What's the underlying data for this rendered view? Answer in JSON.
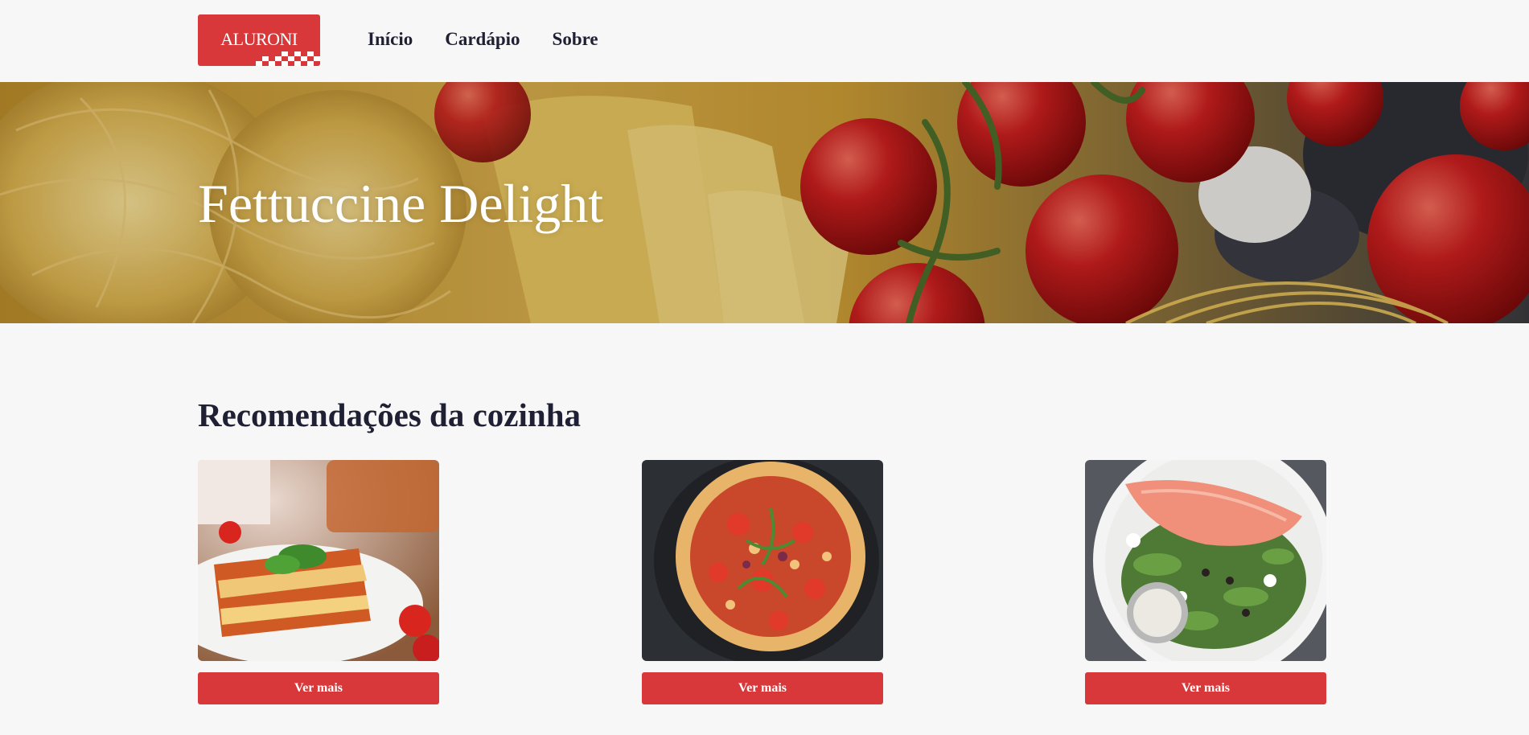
{
  "header": {
    "logo_text": "ALURONI",
    "nav": [
      {
        "label": "Início"
      },
      {
        "label": "Cardápio"
      },
      {
        "label": "Sobre"
      }
    ]
  },
  "hero": {
    "title": "Fettuccine Delight"
  },
  "recommendations": {
    "title": "Recomendações da cozinha",
    "cards": [
      {
        "image": "lasagna-photo",
        "button_label": "Ver mais"
      },
      {
        "image": "pizza-photo",
        "button_label": "Ver mais"
      },
      {
        "image": "salmon-salad-photo",
        "button_label": "Ver mais"
      }
    ]
  },
  "colors": {
    "brand_red": "#d9383a",
    "text_dark": "#1f2033",
    "background": "#f7f7f7"
  }
}
